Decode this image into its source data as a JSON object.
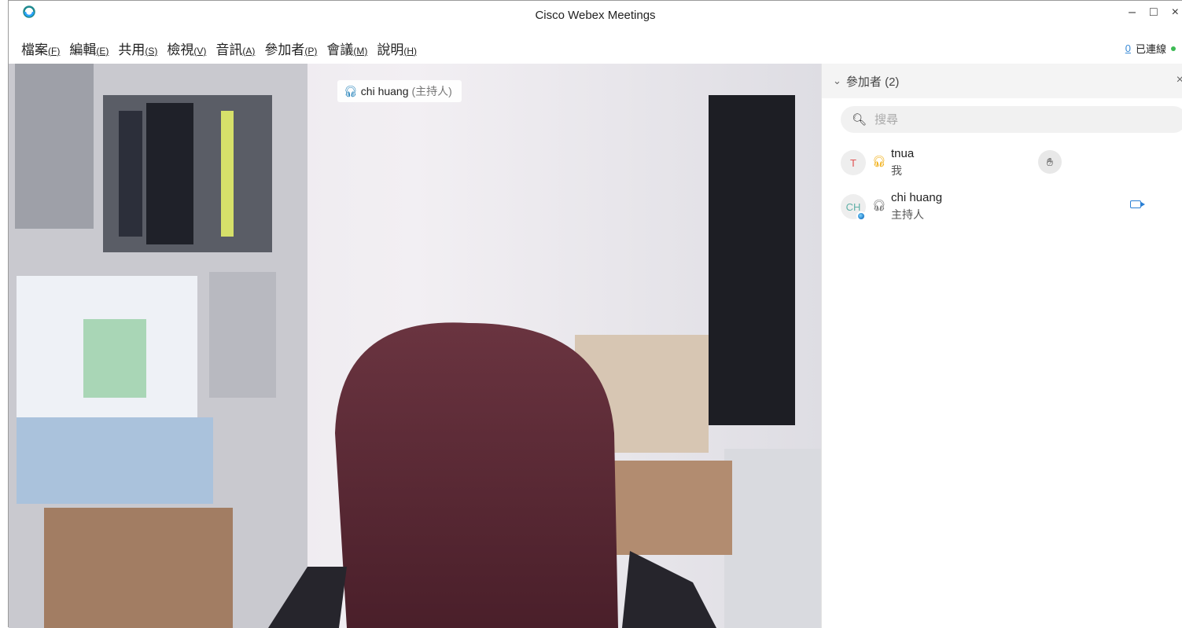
{
  "window": {
    "title": "Cisco Webex Meetings",
    "minimize": "–",
    "maximize": "□",
    "close": "×"
  },
  "menu": [
    {
      "label": "檔案",
      "key": "(F)"
    },
    {
      "label": "編輯",
      "key": "(E)"
    },
    {
      "label": "共用",
      "key": "(S)"
    },
    {
      "label": "檢視",
      "key": "(V)"
    },
    {
      "label": "音訊",
      "key": "(A)"
    },
    {
      "label": "參加者",
      "key": "(P)"
    },
    {
      "label": "會議",
      "key": "(M)"
    },
    {
      "label": "說明",
      "key": "(H)"
    }
  ],
  "connection": {
    "hint": "0",
    "status": "已連線"
  },
  "video": {
    "speaker_name": "chi huang",
    "speaker_role": "(主持人)"
  },
  "participants_panel": {
    "header": "參加者 (2)",
    "search_placeholder": "搜尋",
    "items": [
      {
        "initials": "T",
        "name": "tnua",
        "sub": "我"
      },
      {
        "initials": "CH",
        "name": "chi huang",
        "sub": "主持人"
      }
    ]
  },
  "colors": {
    "accent": "#2a7fd4",
    "connected": "#3cba54",
    "speaking": "#f0a800"
  }
}
